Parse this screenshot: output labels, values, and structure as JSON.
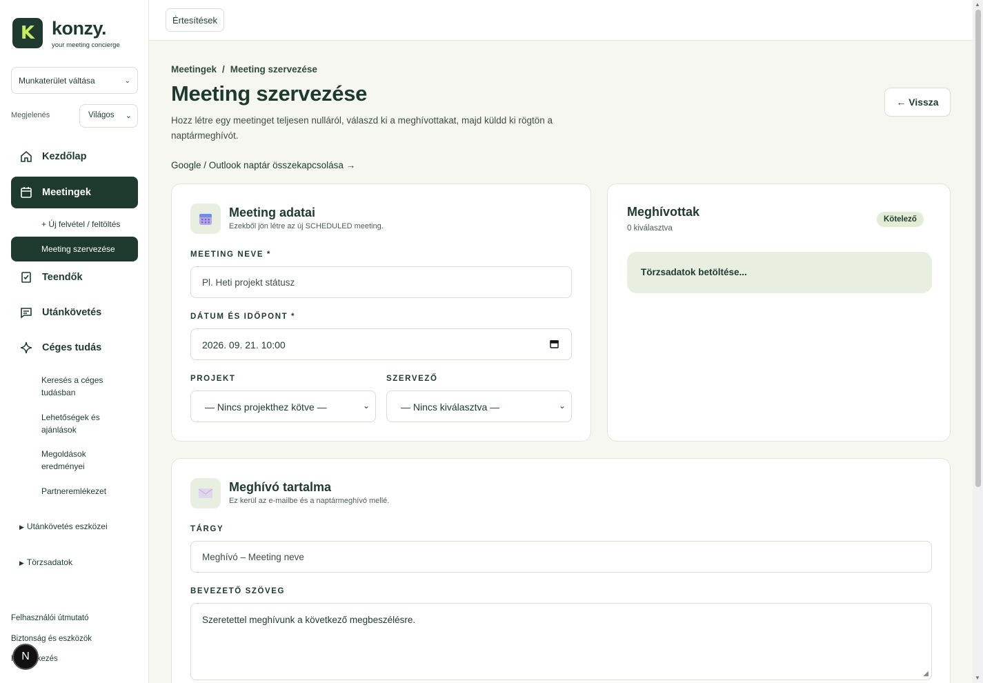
{
  "brand": {
    "name": "konzy.",
    "tagline": "your meeting concierge",
    "mark": "K",
    "accent": "#1e3a2f",
    "accent_light": "#c8ec5c"
  },
  "sidebar": {
    "workspace_switch": "Munkaterület váltása",
    "appearance_label": "Megjelenés",
    "appearance_value": "Világos",
    "nav": [
      {
        "label": "Kezdőlap",
        "icon": "home-icon"
      },
      {
        "label": "Meetingek",
        "icon": "calendar-icon"
      },
      {
        "label": "Teendők",
        "icon": "checkbox-icon"
      },
      {
        "label": "Utánkövetés",
        "icon": "message-icon"
      },
      {
        "label": "Céges tudás",
        "icon": "sparkle-icon"
      }
    ],
    "meeting_sub": [
      "+ Új felvétel / feltöltés",
      "Meeting szervezése"
    ],
    "knowledge_sub": [
      "Keresés a céges tudásban",
      "Lehetőségek és ajánlások",
      "Megoldások eredményei",
      "Partneremlékezet"
    ],
    "groups": [
      "Utánkövetés eszközei",
      "Törzsadatok"
    ],
    "footer": [
      "Felhasználói útmutató",
      "Biztonság és eszközök",
      "Kijelentkezés"
    ],
    "badge": "N"
  },
  "topbar": {
    "notifications": "Értesítések"
  },
  "page": {
    "breadcrumb": [
      "Meetingek",
      "Meeting szervezése"
    ],
    "title": "Meeting szervezése",
    "description": "Hozz létre egy meetinget teljesen nulláról, válaszd ki a meghívottakat, majd küldd ki rögtön a naptármeghívót.",
    "calendar_link": "Google / Outlook naptár összekapcsolása →",
    "back_button": "← Vissza"
  },
  "meeting_card": {
    "title": "Meeting adatai",
    "subtitle": "Ezekből jön létre az új SCHEDULED meeting.",
    "name_label": "MEETING NEVE *",
    "name_placeholder": "Pl. Heti projekt státusz",
    "datetime_label": "DÁTUM ÉS IDŐPONT *",
    "datetime_value": "2026. 09. 21. 10:00",
    "project_label": "PROJEKT",
    "project_value": "— Nincs projekthez kötve —",
    "organizer_label": "SZERVEZŐ",
    "organizer_value": "— Nincs kiválasztva —"
  },
  "invitees_card": {
    "title": "Meghívottak",
    "count": "0 kiválasztva",
    "badge": "Kötelező",
    "loading": "Törzsadatok betöltése..."
  },
  "invite_card": {
    "title": "Meghívó tartalma",
    "subtitle": "Ez kerül az e-mailbe és a naptármeghívó mellé.",
    "subject_label": "TÁRGY",
    "subject_placeholder": "Meghívó – Meeting neve",
    "intro_label": "BEVEZETŐ SZÖVEG",
    "intro_value": "Szeretettel meghívunk a következő megbeszélésre."
  }
}
